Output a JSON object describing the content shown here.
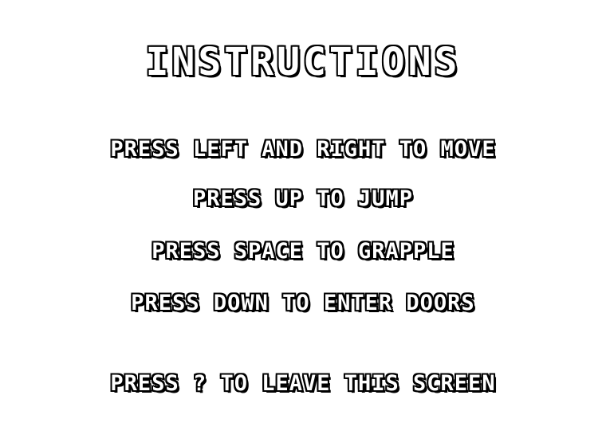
{
  "title": "INSTRUCTIONS",
  "instructions": [
    "PRESS LEFT AND RIGHT TO MOVE",
    "PRESS UP TO JUMP",
    "PRESS SPACE TO GRAPPLE",
    "PRESS DOWN TO ENTER DOORS"
  ],
  "exit_hint": "PRESS ? TO LEAVE THIS SCREEN",
  "colors": {
    "background": "#ffffff",
    "text_fill": "#ffffff",
    "text_outline": "#000000"
  }
}
